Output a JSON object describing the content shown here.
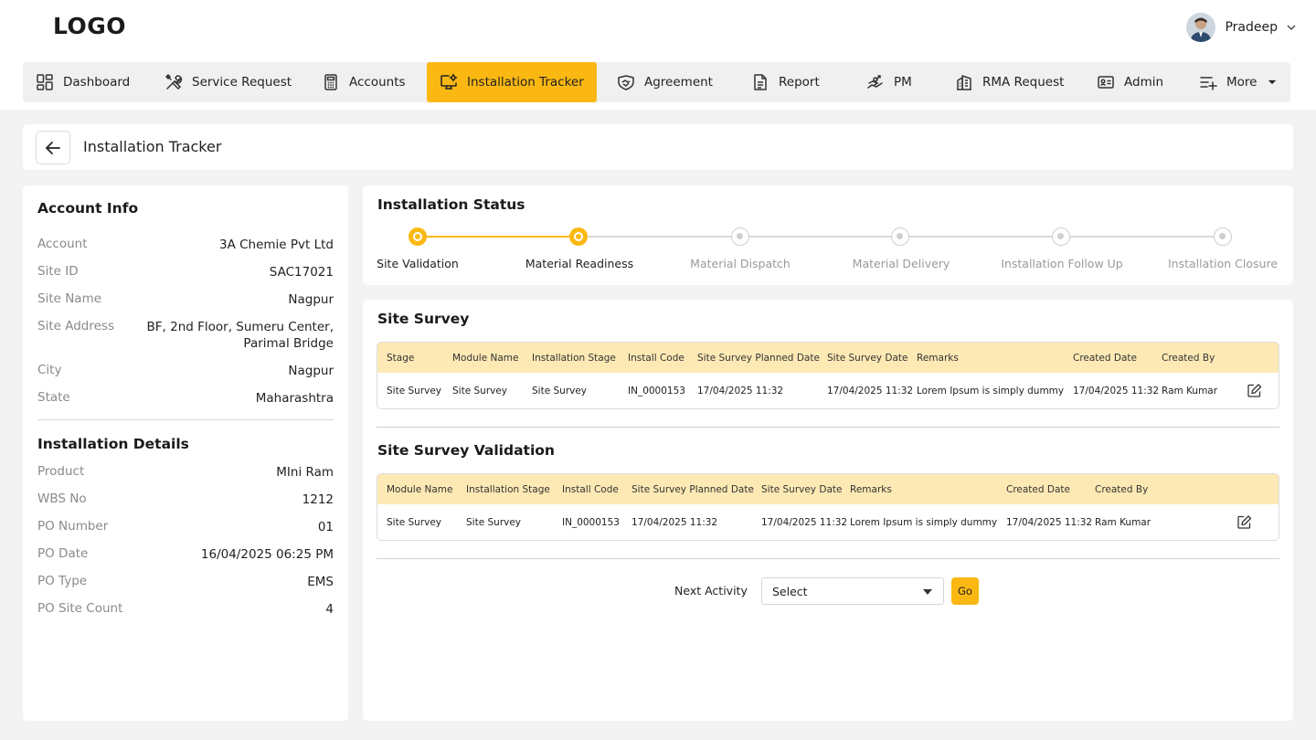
{
  "header": {
    "logo": "LOGO",
    "user_name": "Pradeep"
  },
  "nav": [
    {
      "label": "Dashboard",
      "icon": "dashboard-icon"
    },
    {
      "label": "Service Request",
      "icon": "tools-icon"
    },
    {
      "label": "Accounts",
      "icon": "calculator-icon"
    },
    {
      "label": "Installation Tracker",
      "icon": "monitor-settings-icon",
      "active": true
    },
    {
      "label": "Agreement",
      "icon": "handshake-icon"
    },
    {
      "label": "Report",
      "icon": "document-icon"
    },
    {
      "label": "PM",
      "icon": "maintenance-icon"
    },
    {
      "label": "RMA Request",
      "icon": "building-icon"
    },
    {
      "label": "Admin",
      "icon": "id-card-icon"
    },
    {
      "label": "More",
      "icon": "list-add-icon"
    }
  ],
  "page": {
    "title": "Installation Tracker"
  },
  "account_info": {
    "title": "Account Info",
    "rows": [
      {
        "label": "Account",
        "value": "3A Chemie Pvt Ltd"
      },
      {
        "label": "Site ID",
        "value": "SAC17021"
      },
      {
        "label": "Site Name",
        "value": "Nagpur"
      },
      {
        "label": "Site Address",
        "value": "BF, 2nd Floor, Sumeru Center,",
        "value2": "Parimal Bridge"
      },
      {
        "label": "City",
        "value": "Nagpur"
      },
      {
        "label": "State",
        "value": "Maharashtra"
      }
    ]
  },
  "installation_details": {
    "title": "Installation Details",
    "rows": [
      {
        "label": "Product",
        "value": "MIni Ram"
      },
      {
        "label": "WBS No",
        "value": "1212"
      },
      {
        "label": "PO Number",
        "value": "01"
      },
      {
        "label": "PO Date",
        "value": "16/04/2025 06:25 PM"
      },
      {
        "label": "PO Type",
        "value": "EMS"
      },
      {
        "label": "PO Site Count",
        "value": "4"
      }
    ]
  },
  "installation_status": {
    "title": "Installation Status",
    "steps": [
      {
        "label": "Site Validation",
        "done": true
      },
      {
        "label": "Material Readiness",
        "done": true
      },
      {
        "label": "Material Dispatch",
        "done": false
      },
      {
        "label": "Material Delivery",
        "done": false
      },
      {
        "label": "Installation Follow Up",
        "done": false
      },
      {
        "label": "Installation Closure",
        "done": false
      }
    ],
    "colors": {
      "done": "#fbb812",
      "pending": "#cfcfcf"
    }
  },
  "site_survey": {
    "title": "Site Survey",
    "headers": [
      "Stage",
      "Module Name",
      "Installation Stage",
      "Install Code",
      "Site Survey Planned Date",
      "Site Survey Date",
      "Remarks",
      "Created Date",
      "Created By"
    ],
    "rows": [
      [
        "Site Survey",
        "Site Survey",
        "Site Survey",
        "IN_0000153",
        "17/04/2025 11:32",
        "17/04/2025 11:32",
        "Lorem Ipsum is simply dummy",
        "17/04/2025 11:32",
        "Ram Kumar"
      ]
    ]
  },
  "site_survey_validation": {
    "title": "Site Survey Validation",
    "headers": [
      "Module Name",
      "Installation Stage",
      "Install Code",
      "Site Survey Planned Date",
      "Site Survey Date",
      "Remarks",
      "Created Date",
      "Created By"
    ],
    "rows": [
      [
        "Site Survey",
        "Site Survey",
        "IN_0000153",
        "17/04/2025 11:32",
        "17/04/2025 11:32",
        "Lorem Ipsum is simply dummy",
        "17/04/2025 11:32",
        "Ram Kumar"
      ]
    ]
  },
  "next_activity": {
    "label": "Next Activity",
    "selected": "Select",
    "go_label": "Go"
  },
  "theme": {
    "accent": "#fbb812",
    "table_header": "#fde9b4"
  }
}
